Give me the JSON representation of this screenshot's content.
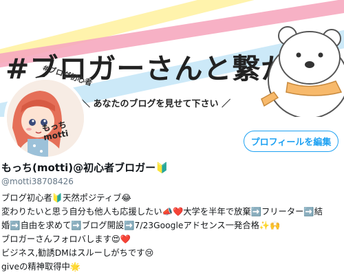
{
  "banner": {
    "title": "#ブロガーさんと繋がりたい",
    "subtitle": "あなたのブログを見せて下さい"
  },
  "avatar": {
    "tag_text": "#ブログ初心者",
    "name_jp": "もっち",
    "name_en": "motti"
  },
  "profile": {
    "edit_label": "プロフィールを編集",
    "display_name": "もっち(motti)@初心者ブロガー🔰",
    "handle": "@motti38708426",
    "bio": [
      "ブログ初心者🔰天然ポジティブ😂",
      "変わりたいと思う自分も他人も応援したい📣❤️大学を半年で放棄➡️フリーター➡️結",
      "婚➡️自由を求めて➡️ブログ開設➡️7/23Googleアドセンス一発合格✨🙌",
      "ブロガーさんフォロバします😍❤️",
      "ビジネス,勧誘DMはスルーしがちです😢",
      "giveの精神取得中🌟"
    ]
  },
  "colors": {
    "accent": "#1da1f2",
    "handle": "#657786"
  }
}
